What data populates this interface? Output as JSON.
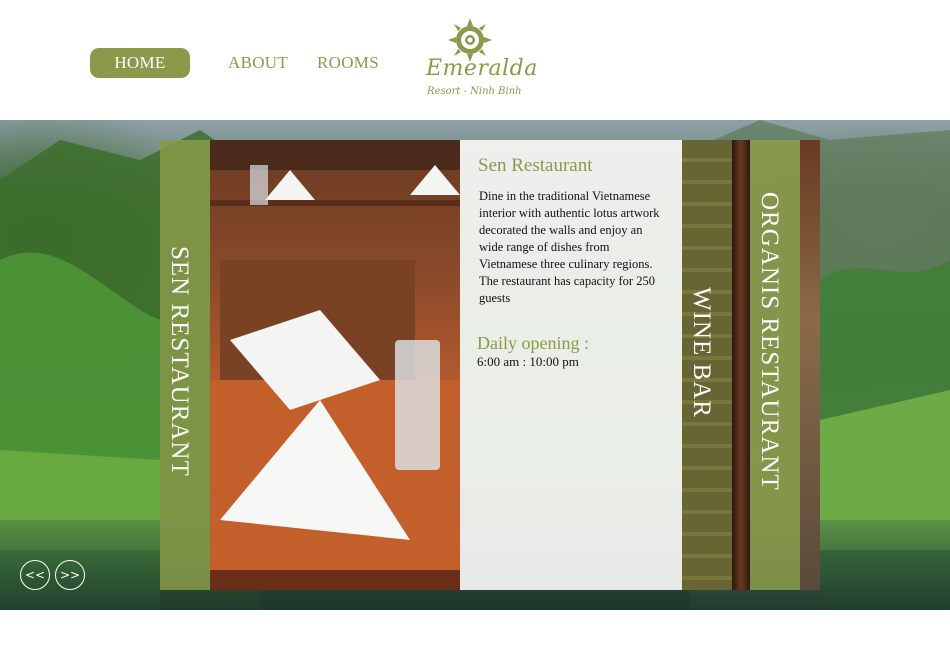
{
  "nav": {
    "home": "HOME",
    "about": "ABOUT",
    "rooms": "ROOMS"
  },
  "logo": {
    "name": "Emeralda",
    "tagline": "Resort - Ninh Binh"
  },
  "panels": {
    "left_title": "SEN RESTAURANT",
    "wine_title": "WINE BAR",
    "organis_title": "ORGANIS RESTAURANT"
  },
  "info": {
    "title": "Sen Restaurant",
    "description": "Dine in the traditional Vietnamese interior with authentic lotus artwork decorated the walls and enjoy an wide range of dishes from Vietnamese three culinary regions. The restaurant has capacity for 250 guests",
    "hours_label": "Daily opening :",
    "hours": "6:00 am : 10:00 pm"
  },
  "controls": {
    "prev": "<<",
    "next": ">>"
  },
  "colors": {
    "accent": "#8a9a4a",
    "text": "#111111",
    "panel": "#f6f6f4"
  }
}
